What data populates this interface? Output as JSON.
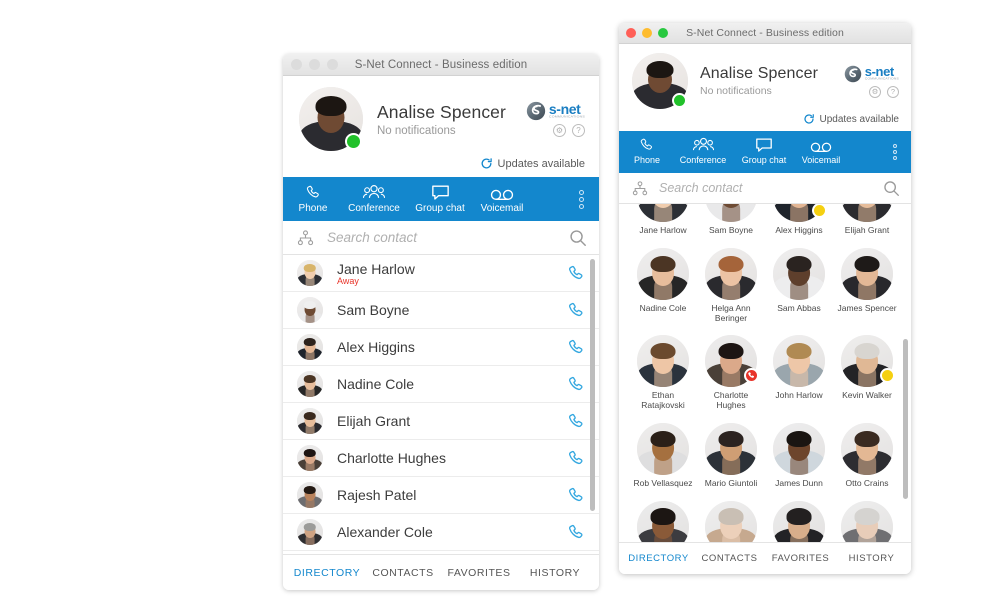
{
  "app": {
    "window_title": "S-Net Connect - Business edition",
    "brand": {
      "name": "s-net",
      "tagline": "COMMUNICATIONS",
      "accent_blue": "#1387cd",
      "icon_blue": "#35a8e0"
    }
  },
  "profile": {
    "name": "Analise Spencer",
    "status_text": "No notifications",
    "presence": "online",
    "avatar_icon": "user-photo",
    "settings_icon": "gear-icon",
    "help_icon": "question-mark-icon"
  },
  "updates": {
    "label": "Updates available",
    "icon": "refresh-icon"
  },
  "nav": {
    "items": [
      {
        "label": "Phone",
        "icon": "phone-icon"
      },
      {
        "label": "Conference",
        "icon": "group-people-icon"
      },
      {
        "label": "Group chat",
        "icon": "chat-bubble-icon"
      },
      {
        "label": "Voicemail",
        "icon": "voicemail-icon"
      }
    ],
    "overflow_icon": "kebab-menu-icon"
  },
  "search": {
    "placeholder": "Search contact",
    "value": "",
    "left_icon": "org-tree-icon",
    "right_icon": "search-icon"
  },
  "tabs": {
    "items": [
      {
        "label": "DIRECTORY",
        "active": true
      },
      {
        "label": "CONTACTS",
        "active": false
      },
      {
        "label": "FAVORITES",
        "active": false
      },
      {
        "label": "HISTORY",
        "active": false
      }
    ]
  },
  "left_window": {
    "title": "S-Net Connect - Business edition",
    "traffic_lights": "inactive",
    "list": [
      {
        "name": "Jane Harlow",
        "sub": "Away",
        "call_icon": "phone-handset-icon",
        "skin": "f1"
      },
      {
        "name": "Sam Boyne",
        "sub": "",
        "call_icon": "phone-handset-icon",
        "skin": "m1"
      },
      {
        "name": "Alex Higgins",
        "sub": "",
        "call_icon": "phone-handset-icon",
        "skin": "m2"
      },
      {
        "name": "Nadine Cole",
        "sub": "",
        "call_icon": "phone-handset-icon",
        "skin": "f2"
      },
      {
        "name": "Elijah Grant",
        "sub": "",
        "call_icon": "phone-handset-icon",
        "skin": "m3"
      },
      {
        "name": "Charlotte Hughes",
        "sub": "",
        "call_icon": "phone-handset-icon",
        "skin": "f3"
      },
      {
        "name": "Rajesh Patel",
        "sub": "",
        "call_icon": "phone-handset-icon",
        "skin": "m4"
      },
      {
        "name": "Alexander Cole",
        "sub": "",
        "call_icon": "phone-handset-icon",
        "skin": "m5"
      }
    ]
  },
  "right_window": {
    "title": "S-Net Connect - Business edition",
    "traffic_lights": "active",
    "grid": [
      {
        "name": "Jane Harlow",
        "badge": "",
        "skin": "f1"
      },
      {
        "name": "Sam Boyne",
        "badge": "",
        "skin": "m1"
      },
      {
        "name": "Alex Higgins",
        "badge": "away",
        "skin": "m2"
      },
      {
        "name": "Elijah Grant",
        "badge": "",
        "skin": "m3"
      },
      {
        "name": "Nadine Cole",
        "badge": "",
        "skin": "f2"
      },
      {
        "name": "Helga Ann Beringer",
        "badge": "",
        "skin": "f4"
      },
      {
        "name": "Sam Abbas",
        "badge": "",
        "skin": "m6"
      },
      {
        "name": "James Spencer",
        "badge": "",
        "skin": "m7"
      },
      {
        "name": "Ethan Ratajkovski",
        "badge": "",
        "skin": "m8"
      },
      {
        "name": "Charlotte Hughes",
        "badge": "busy",
        "skin": "f3"
      },
      {
        "name": "John Harlow",
        "badge": "",
        "skin": "m9"
      },
      {
        "name": "Kevin Walker",
        "badge": "away",
        "skin": "m10"
      },
      {
        "name": "Rob Vellasquez",
        "badge": "",
        "skin": "m11"
      },
      {
        "name": "Mario Giuntoli",
        "badge": "",
        "skin": "m12"
      },
      {
        "name": "James Dunn",
        "badge": "",
        "skin": "m13"
      },
      {
        "name": "Otto Crains",
        "badge": "",
        "skin": "m14"
      },
      {
        "name": "",
        "badge": "",
        "skin": "m15"
      },
      {
        "name": "",
        "badge": "",
        "skin": "f5"
      },
      {
        "name": "",
        "badge": "",
        "skin": "m16"
      },
      {
        "name": "",
        "badge": "",
        "skin": "f6"
      }
    ]
  }
}
